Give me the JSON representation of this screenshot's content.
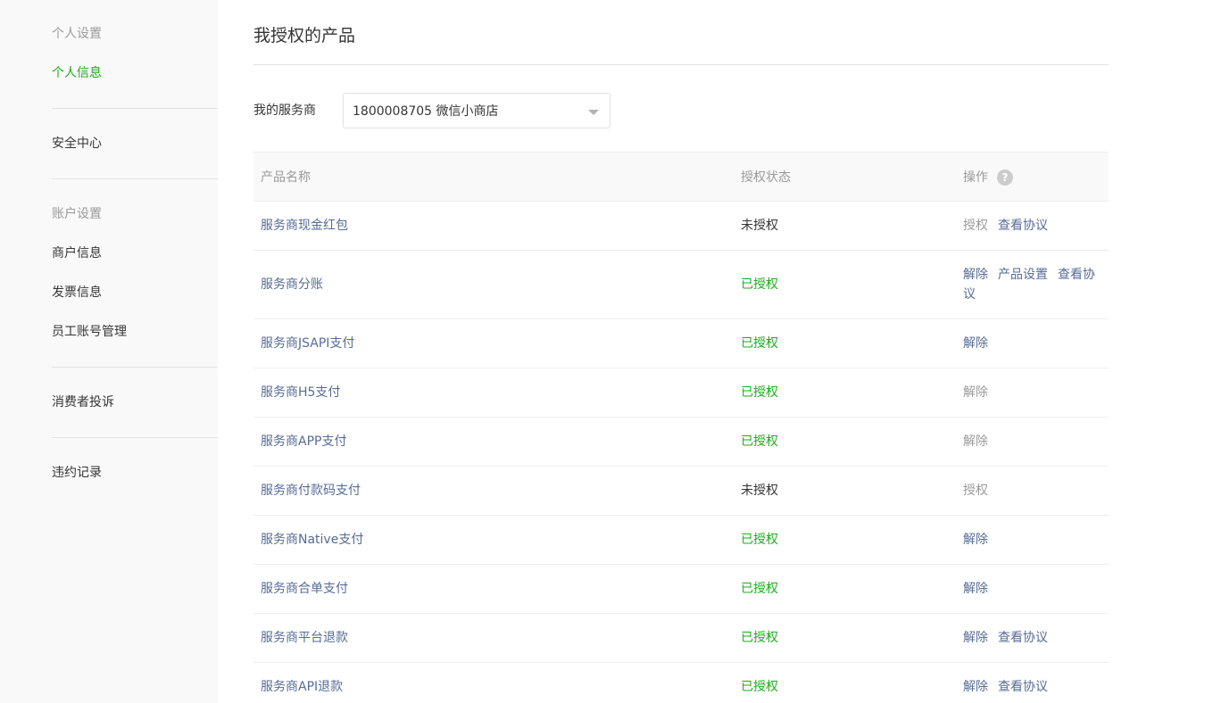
{
  "sidebar": {
    "group1_heading": "个人设置",
    "personal_info": "个人信息",
    "security_center": "安全中心",
    "group2_heading": "账户设置",
    "merchant_info": "商户信息",
    "invoice_info": "发票信息",
    "staff_accounts": "员工账号管理",
    "consumer_complaints": "消费者投诉",
    "violation_records": "违约记录"
  },
  "page": {
    "title": "我授权的产品",
    "provider_label": "我的服务商",
    "provider_selected": "1800008705 微信小商店"
  },
  "table": {
    "headers": {
      "name": "产品名称",
      "status": "授权状态",
      "ops": "操作",
      "help_icon": "?"
    },
    "rows": [
      {
        "name": "服务商现金红包",
        "status": "未授权",
        "authorized": false,
        "ops": [
          {
            "label": "授权",
            "disabled": true
          },
          {
            "label": "查看协议",
            "disabled": false
          }
        ]
      },
      {
        "name": "服务商分账",
        "status": "已授权",
        "authorized": true,
        "ops_text": [
          {
            "label": "解除"
          },
          {
            "label": "产品设置"
          },
          {
            "label": "查看协议"
          }
        ]
      },
      {
        "name": "服务商JSAPI支付",
        "status": "已授权",
        "authorized": true,
        "ops": [
          {
            "label": "解除",
            "disabled": false
          }
        ]
      },
      {
        "name": "服务商H5支付",
        "status": "已授权",
        "authorized": true,
        "ops": [
          {
            "label": "解除",
            "disabled": true
          }
        ]
      },
      {
        "name": "服务商APP支付",
        "status": "已授权",
        "authorized": true,
        "ops": [
          {
            "label": "解除",
            "disabled": true
          }
        ]
      },
      {
        "name": "服务商付款码支付",
        "status": "未授权",
        "authorized": false,
        "ops": [
          {
            "label": "授权",
            "disabled": true
          }
        ]
      },
      {
        "name": "服务商Native支付",
        "status": "已授权",
        "authorized": true,
        "ops": [
          {
            "label": "解除",
            "disabled": false
          }
        ]
      },
      {
        "name": "服务商合单支付",
        "status": "已授权",
        "authorized": true,
        "ops": [
          {
            "label": "解除",
            "disabled": false
          }
        ]
      },
      {
        "name": "服务商平台退款",
        "status": "已授权",
        "authorized": true,
        "ops": [
          {
            "label": "解除",
            "disabled": false
          },
          {
            "label": "查看协议",
            "disabled": false
          }
        ]
      },
      {
        "name": "服务商API退款",
        "status": "已授权",
        "authorized": true,
        "ops": [
          {
            "label": "解除",
            "disabled": false
          },
          {
            "label": "查看协议",
            "disabled": false
          }
        ]
      }
    ]
  },
  "colors": {
    "brand_green": "#1aad19",
    "link_blue": "#576b95",
    "muted_gray": "#9a9a9a"
  }
}
